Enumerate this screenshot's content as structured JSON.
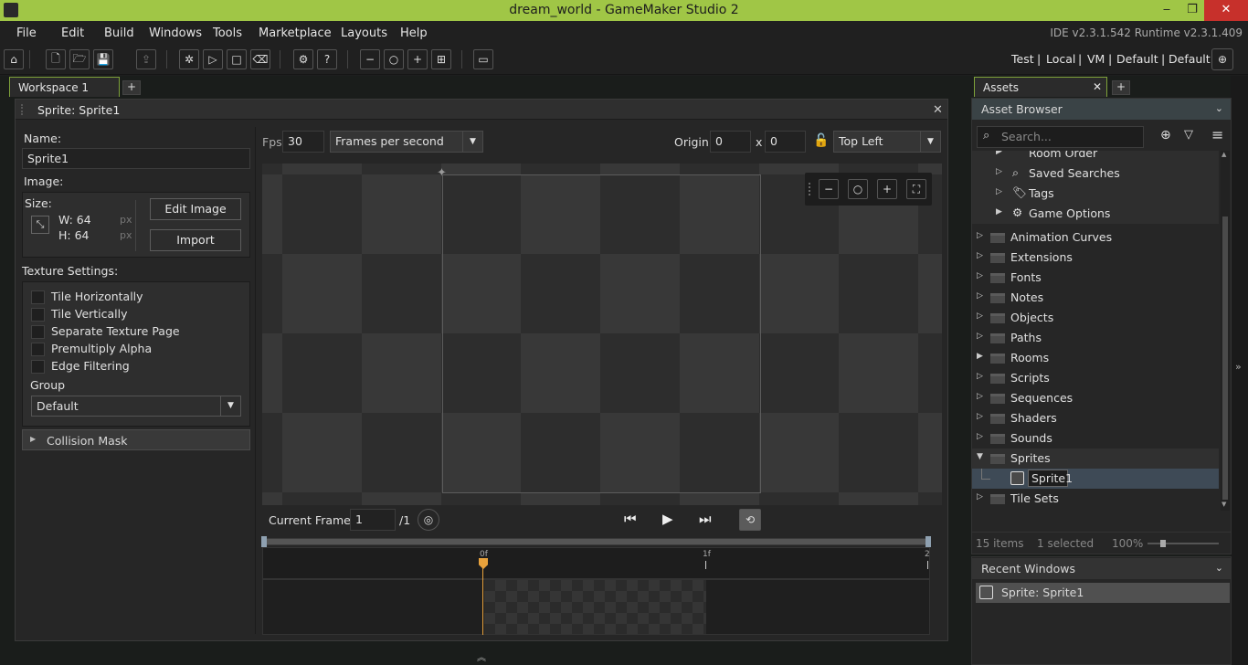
{
  "window": {
    "title": "dream_world - GameMaker Studio 2",
    "min": "‒",
    "restore": "❐",
    "close": "✕"
  },
  "menu": {
    "items": [
      "File",
      "Edit",
      "Build",
      "Windows",
      "Tools",
      "Marketplace",
      "Layouts",
      "Help"
    ],
    "version": "IDE v2.3.1.542  Runtime v2.3.1.409"
  },
  "toolbar": {
    "target": {
      "test": "Test",
      "sep": "|",
      "local": "Local",
      "vm": "VM",
      "default1": "Default",
      "default2": "Default"
    }
  },
  "workspace": {
    "tab_label": "Workspace 1",
    "add_tab": "+"
  },
  "sprite_editor": {
    "title": "Sprite: Sprite1",
    "close": "✕",
    "name_label": "Name:",
    "name_value": "Sprite1",
    "image_label": "Image:",
    "size_label": "Size:",
    "width": "W: 64",
    "height": "H: 64",
    "px": "px",
    "edit_image": "Edit Image",
    "import": "Import",
    "texture_settings": "Texture Settings:",
    "checkboxes": [
      "Tile Horizontally",
      "Tile Vertically",
      "Separate Texture Page",
      "Premultiply Alpha",
      "Edge Filtering"
    ],
    "group_label": "Group",
    "group_value": "Default",
    "collision_mask": "Collision Mask",
    "fps_label": "Fps",
    "fps_value": "30",
    "fps_mode": "Frames per second",
    "origin_label": "Origin",
    "origin_x": "0",
    "origin_x_sep": "x",
    "origin_y": "0",
    "origin_preset": "Top Left",
    "current_frame_label": "Current Frame:",
    "current_frame_value": "1",
    "frame_total": "/1",
    "timeline": {
      "tick0": "0f",
      "tick1": "1f",
      "tick2": "2"
    }
  },
  "assets": {
    "tab_label": "Assets",
    "tab_close": "✕",
    "add_tab": "+",
    "browser_label": "Asset Browser",
    "search_placeholder": "Search...",
    "quick_access": [
      "Room Order",
      "Saved Searches",
      "Tags",
      "Game Options"
    ],
    "folders": [
      "Animation Curves",
      "Extensions",
      "Fonts",
      "Notes",
      "Objects",
      "Paths",
      "Rooms",
      "Scripts",
      "Sequences",
      "Shaders",
      "Sounds",
      "Sprites",
      "Tile Sets"
    ],
    "selected_item": "Sprite1",
    "status": {
      "items": "15 items",
      "selected": "1 selected",
      "zoom": "100%"
    },
    "recent_label": "Recent Windows",
    "recent_items": [
      "Sprite: Sprite1"
    ]
  },
  "colors": {
    "accent": "#a0c646",
    "playhead": "#e8a23c"
  }
}
